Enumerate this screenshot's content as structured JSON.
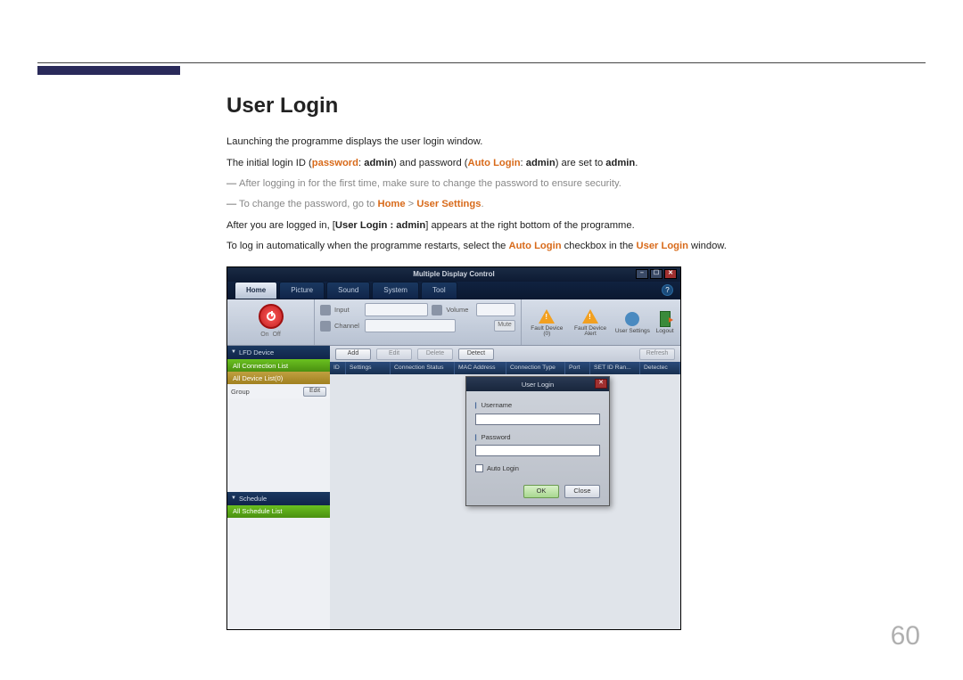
{
  "page_number": "60",
  "doc": {
    "title": "User Login",
    "p1": "Launching the programme displays the user login window.",
    "p2a": "The initial login ID (",
    "p2_pw": "password",
    "p2b": ": ",
    "p2_admin1": "admin",
    "p2c": ") and password (",
    "p2_al": "Auto Login",
    "p2d": ": ",
    "p2_admin2": "admin",
    "p2e": ") are set to ",
    "p2_admin3": "admin",
    "p2f": ".",
    "d1": "After logging in for the first time, make sure to change the password to ensure security.",
    "d2a": "To change the password, go to ",
    "d2_home": "Home",
    "d2b": " > ",
    "d2_us": "User Settings",
    "d2c": ".",
    "p3a": "After you are logged in, [",
    "p3_ul": "User Login : admin",
    "p3b": "] appears at the right bottom of the programme.",
    "p4a": "To log in automatically when the programme restarts, select the ",
    "p4_al": "Auto Login",
    "p4b": " checkbox in the ",
    "p4_ul": "User Login",
    "p4c": " window."
  },
  "app": {
    "title": "Multiple Display Control",
    "tabs": [
      "Home",
      "Picture",
      "Sound",
      "System",
      "Tool"
    ],
    "power": {
      "on": "On",
      "off": "Off"
    },
    "ribbon": {
      "input": "Input",
      "channel": "Channel",
      "volume": "Volume",
      "mute": "Mute"
    },
    "tools": [
      {
        "label": "Fault Device (0)"
      },
      {
        "label": "Fault Device Alert"
      },
      {
        "label": "User Settings"
      },
      {
        "label": "Logout"
      }
    ],
    "sidebar": {
      "lfd_header": "LFD Device",
      "all_conn": "All Connection List",
      "all_dev": "All Device List(0)",
      "group": "Group",
      "edit": "Edit",
      "schedule_header": "Schedule",
      "all_schedule": "All Schedule List"
    },
    "toolbar": {
      "add": "Add",
      "edit": "Edit",
      "delete": "Delete",
      "detect": "Detect",
      "refresh": "Refresh"
    },
    "columns": [
      "ID",
      "Settings",
      "Connection Status",
      "MAC Address",
      "Connection Type",
      "Port",
      "SET ID Ran...",
      "Detectec"
    ]
  },
  "login": {
    "title": "User Login",
    "username": "Username",
    "password": "Password",
    "auto": "Auto Login",
    "ok": "OK",
    "close": "Close"
  }
}
